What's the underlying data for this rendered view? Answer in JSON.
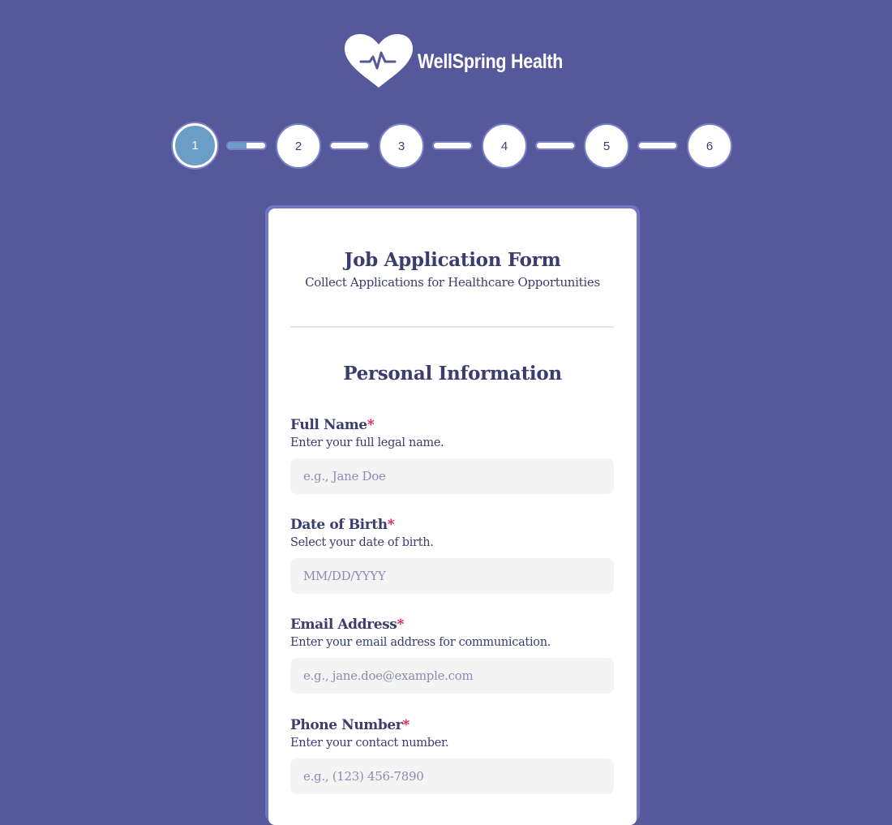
{
  "brand": {
    "name": "WellSpring Health",
    "logo_icon": "heart-pulse-icon"
  },
  "colors": {
    "background": "#55599c",
    "accent": "#6b9ec6",
    "text": "#3a3d6e",
    "required": "#e0185e"
  },
  "stepper": {
    "current_step": 1,
    "first_connector_progress": 0.5,
    "steps": [
      {
        "label": "1",
        "state": "active"
      },
      {
        "label": "2",
        "state": "pending"
      },
      {
        "label": "3",
        "state": "pending"
      },
      {
        "label": "4",
        "state": "pending"
      },
      {
        "label": "5",
        "state": "pending"
      },
      {
        "label": "6",
        "state": "pending"
      }
    ]
  },
  "form": {
    "title": "Job Application Form",
    "subtitle": "Collect Applications for Healthcare Opportunities",
    "section_title": "Personal Information",
    "fields": [
      {
        "label": "Full Name",
        "required_mark": "*",
        "help": "Enter your full legal name.",
        "placeholder": "e.g., Jane Doe",
        "value": ""
      },
      {
        "label": "Date of Birth",
        "required_mark": "*",
        "help": "Select your date of birth.",
        "placeholder": "MM/DD/YYYY",
        "value": ""
      },
      {
        "label": "Email Address",
        "required_mark": "*",
        "help": "Enter your email address for communication.",
        "placeholder": "e.g., jane.doe@example.com",
        "value": ""
      },
      {
        "label": "Phone Number",
        "required_mark": "*",
        "help": "Enter your contact number.",
        "placeholder": "e.g., (123) 456-7890",
        "value": ""
      }
    ]
  }
}
